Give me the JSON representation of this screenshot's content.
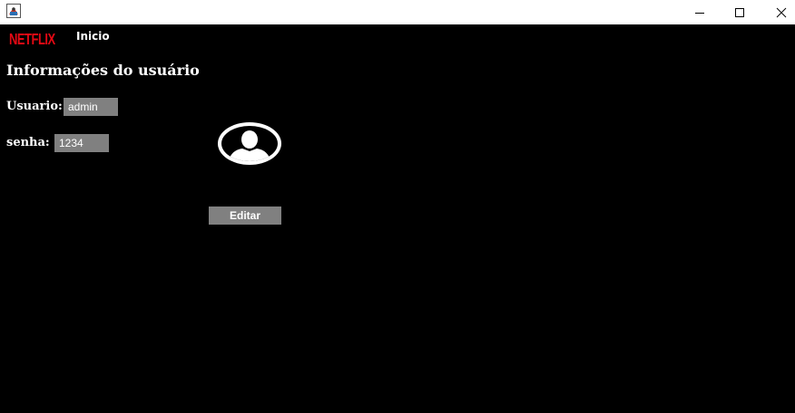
{
  "window": {
    "controls": {
      "minimize_icon": "minimize-icon",
      "maximize_icon": "maximize-icon",
      "close_icon": "close-icon"
    }
  },
  "nav": {
    "logo_text": "NETFLIX",
    "inicio_label": "Inicio"
  },
  "page": {
    "title": "Informações do usuário"
  },
  "form": {
    "user_label": "Usuario:",
    "user_value": "admin",
    "password_label": "senha:",
    "password_value": "1234",
    "edit_label": "Editar"
  },
  "colors": {
    "background": "#000000",
    "logo": "#e50914",
    "field_bg": "#808080",
    "text": "#ffffff"
  }
}
